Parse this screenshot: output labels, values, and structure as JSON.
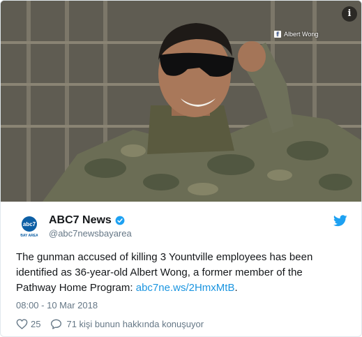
{
  "media": {
    "credit_text": "Albert Wong",
    "credit_icon": "facebook-icon",
    "info_glyph": "i"
  },
  "author": {
    "display_name": "ABC7 News",
    "handle": "@abc7newsbayarea",
    "avatar_logo": "abc7",
    "avatar_sub": "BAY AREA",
    "verified_icon": "verified-badge-icon"
  },
  "tweet": {
    "text": "The gunman accused of killing 3 Yountville employees has been identified as 36-year-old Albert Wong, a former member of the Pathway Home Program: ",
    "link": "abc7ne.ws/2HmxMtB",
    "link_suffix": ".",
    "timestamp": "08:00 - 10 Mar 2018"
  },
  "actions": {
    "like_count": "25",
    "reply_text": "71 kişi bunun hakkında konuşuyor"
  },
  "colors": {
    "link": "#1b95e0",
    "twitter_blue": "#1da1f2",
    "text_muted": "#657786",
    "abc_blue": "#0d5fa5"
  }
}
